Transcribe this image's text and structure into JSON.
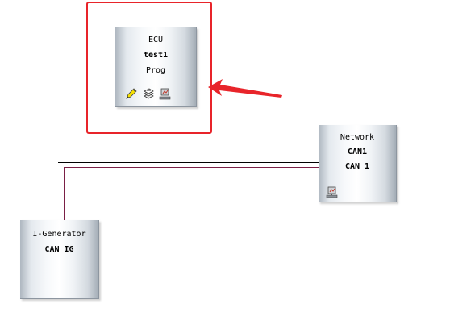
{
  "nodes": {
    "ecu": {
      "type_label": "ECU",
      "name": "test1",
      "sub": "Prog",
      "icons": [
        "pencil-icon",
        "stack-icon",
        "network-port-icon"
      ]
    },
    "network": {
      "type_label": "Network",
      "name": "CAN1",
      "sub": "CAN 1",
      "icons": [
        "network-port-icon"
      ]
    },
    "igen": {
      "type_label": "I-Generator",
      "name": "CAN IG"
    }
  },
  "colors": {
    "connection_line": "#7a1f45",
    "bus_line": "#000000",
    "highlight": "#e8242a",
    "arrow": "#e8242a"
  },
  "annotations": {
    "highlight_target": "ecu",
    "arrow_points_to": "ecu"
  }
}
